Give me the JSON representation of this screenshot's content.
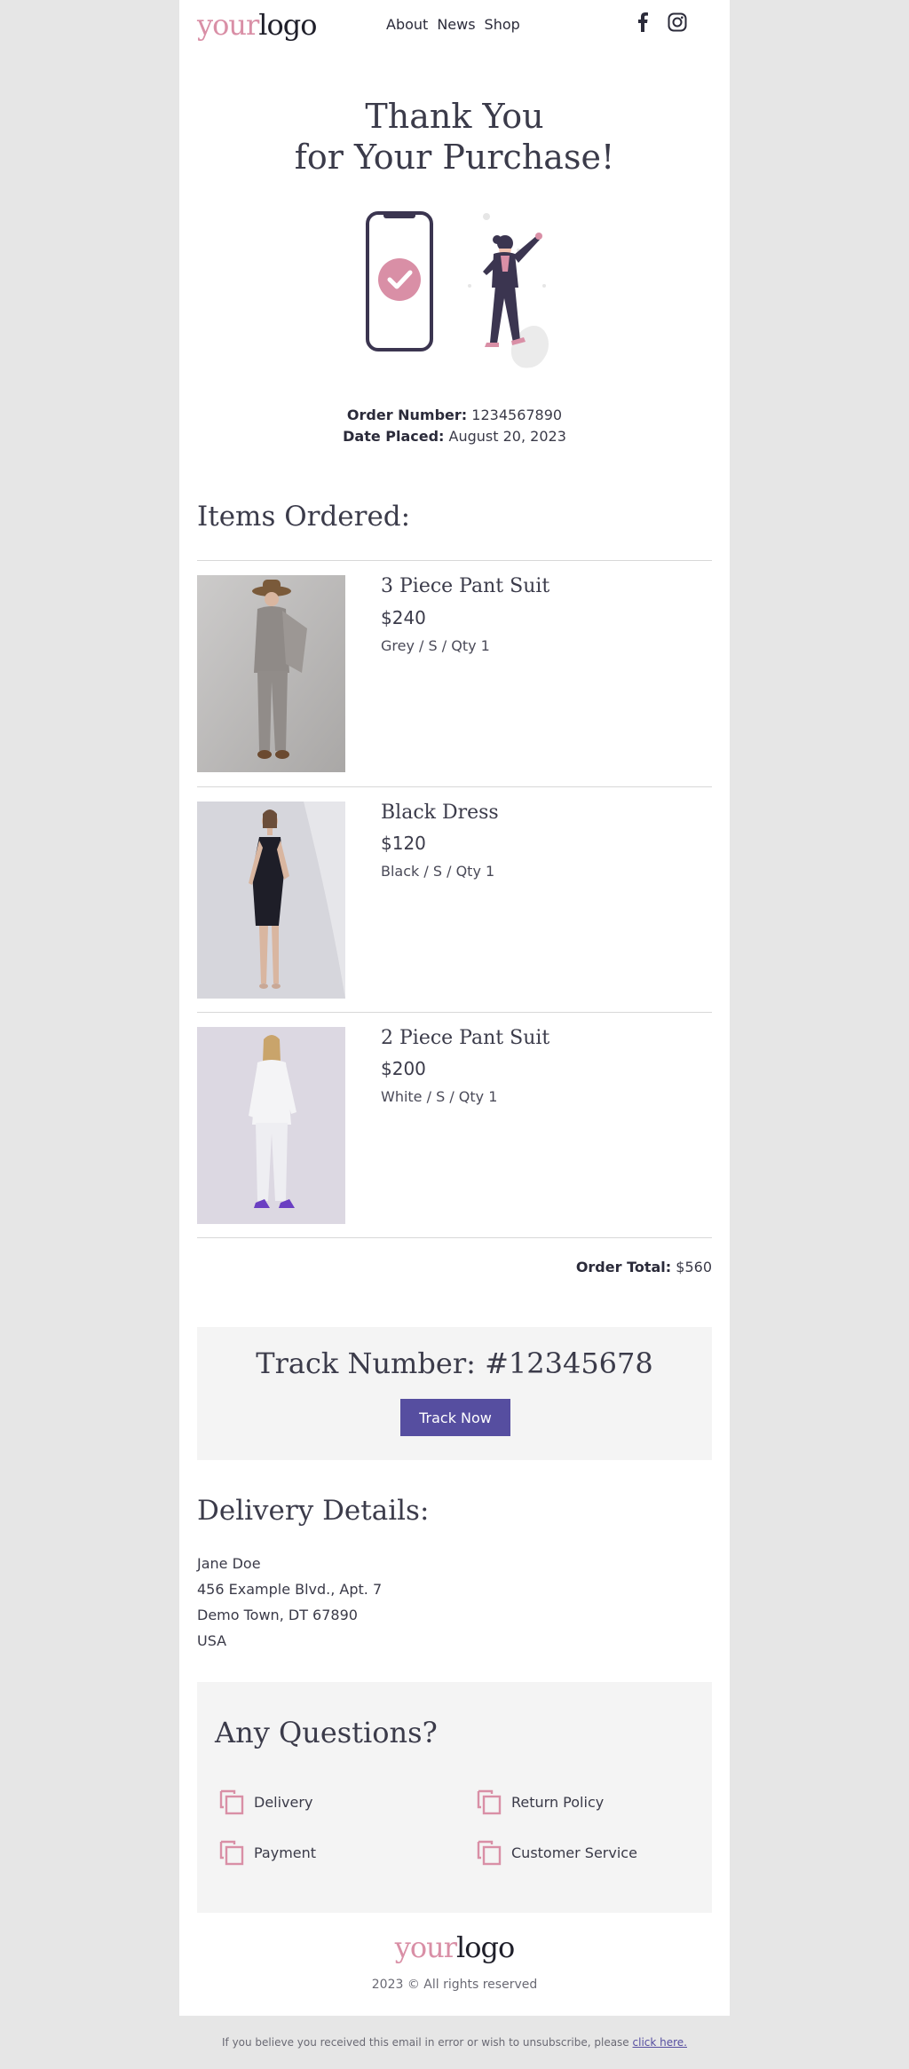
{
  "header": {
    "logo_prefix": "your",
    "logo_suffix": "logo",
    "nav": [
      "About",
      "News",
      "Shop"
    ],
    "social": [
      "facebook-icon",
      "instagram-icon"
    ]
  },
  "hero": {
    "title_line1": "Thank You",
    "title_line2": "for Your Purchase!",
    "order_number_label": "Order Number:",
    "order_number": "1234567890",
    "date_label": "Date Placed:",
    "date": "August 20, 2023"
  },
  "items_heading": "Items Ordered:",
  "items": [
    {
      "name": "3 Piece Pant Suit",
      "price": "$240",
      "variant": "Grey / S / Qty 1"
    },
    {
      "name": "Black Dress",
      "price": "$120",
      "variant": "Black / S / Qty 1"
    },
    {
      "name": "2 Piece Pant Suit",
      "price": "$200",
      "variant": "White / S / Qty 1"
    }
  ],
  "total": {
    "label": "Order Total:",
    "value": "$560"
  },
  "tracking": {
    "title": "Track Number: #12345678",
    "button": "Track Now"
  },
  "delivery": {
    "heading": "Delivery Details:",
    "lines": [
      "Jane Doe",
      "456 Example Blvd., Apt. 7",
      "Demo Town, DT 67890",
      "USA"
    ]
  },
  "questions": {
    "heading": "Any Questions?",
    "links": [
      "Delivery",
      "Return Policy",
      "Payment",
      "Customer Service"
    ]
  },
  "footer": {
    "logo_prefix": "your",
    "logo_suffix": "logo",
    "copyright": "2023 © All rights reserved",
    "unsubscribe_text": "If you believe you received this email in error or wish to unsubscribe, please",
    "unsubscribe_link": "click here."
  },
  "colors": {
    "accent": "#d98fa6",
    "button": "#564ea0",
    "text": "#2b2b3a"
  }
}
